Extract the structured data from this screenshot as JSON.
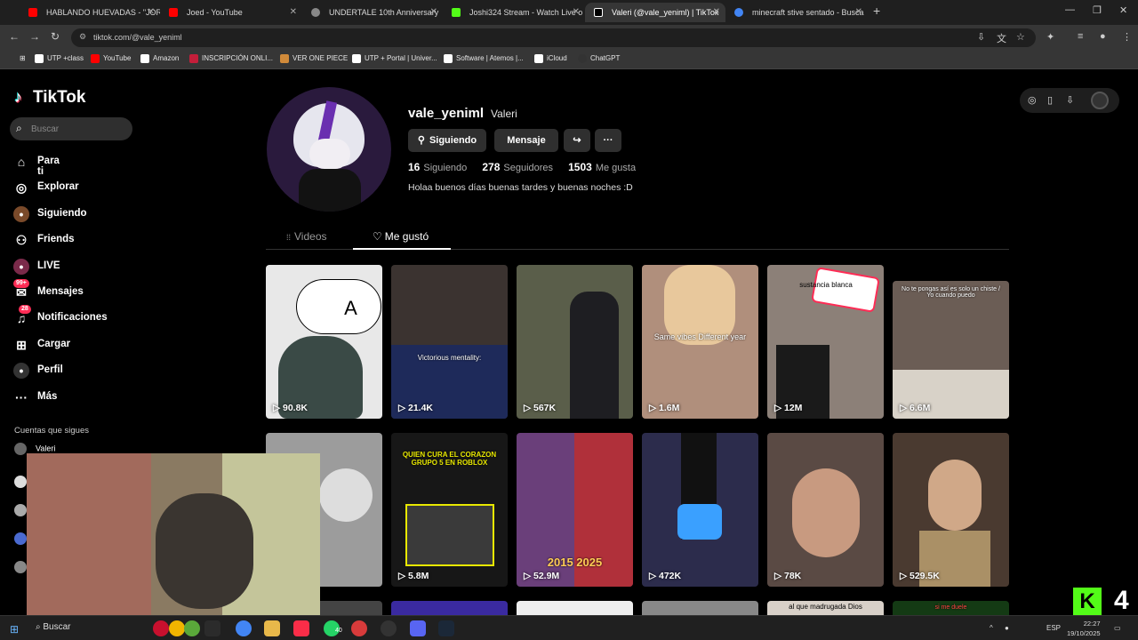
{
  "browser": {
    "tabs": [
      {
        "title": "HABLANDO HUEVADAS - \"JOR",
        "icon": "youtube-icon"
      },
      {
        "title": "Joed - YouTube",
        "icon": "youtube-icon"
      },
      {
        "title": "UNDERTALE 10th Anniversary",
        "icon": "globe-icon"
      },
      {
        "title": "Joshi324 Stream - Watch Live o",
        "icon": "kick-icon"
      },
      {
        "title": "Valeri (@vale_yeniml) | TikTok",
        "icon": "tiktok-icon"
      },
      {
        "title": "minecraft stive sentado - Busca",
        "icon": "google-icon"
      }
    ],
    "url": "tiktok.com/@vale_yeniml",
    "bookmarks": [
      "UTP +class",
      "YouTube",
      "Amazon",
      "INSCRIPCIÓN ONLI...",
      "VER ONE PIECE",
      "UTP + Portal | Univer...",
      "Software | Atemos |...",
      "iCloud",
      "ChatGPT"
    ]
  },
  "tiktok": {
    "logo": "TikTok",
    "search_placeholder": "Buscar",
    "nav": [
      {
        "label": "Para ti",
        "icon": "home-icon"
      },
      {
        "label": "Explorar",
        "icon": "compass-icon"
      },
      {
        "label": "Siguiendo",
        "icon": "following-icon"
      },
      {
        "label": "Friends",
        "icon": "friends-icon"
      },
      {
        "label": "LIVE",
        "icon": "live-icon"
      },
      {
        "label": "Mensajes",
        "icon": "messages-icon",
        "badge": "99+"
      },
      {
        "label": "Notificaciones",
        "icon": "bell-icon",
        "badge": "28"
      },
      {
        "label": "Cargar",
        "icon": "upload-icon"
      },
      {
        "label": "Perfil",
        "icon": "profile-icon"
      },
      {
        "label": "Más",
        "icon": "more-icon"
      }
    ],
    "following_title": "Cuentas que sigues",
    "following": [
      "Valeri"
    ]
  },
  "profile": {
    "username": "vale_yeniml",
    "nickname": "Valeri",
    "btn_following": "Siguiendo",
    "btn_message": "Mensaje",
    "following_count": "16",
    "following_label": "Siguiendo",
    "followers_count": "278",
    "followers_label": "Seguidores",
    "likes_count": "1503",
    "likes_label": "Me gusta",
    "bio": "Holaa buenos días buenas tardes y buenas noches :D",
    "tab_videos": "Videos",
    "tab_liked": "Me gustó"
  },
  "videos": [
    {
      "views": "90.8K",
      "caption": "A",
      "color": "#e8e8e8"
    },
    {
      "views": "21.4K",
      "caption": "Victorious mentality:",
      "color": "#3b3330"
    },
    {
      "views": "567K",
      "caption": "",
      "color": "#5a5e4a"
    },
    {
      "views": "1.6M",
      "caption": "Same vibes Different year",
      "color": "#b08f7c"
    },
    {
      "views": "12M",
      "caption": "sustancia blanca",
      "color": "#8c8078"
    },
    {
      "views": "6.6M",
      "caption": "No te pongas así es solo un chiste / Yo cuando puedo",
      "color": "#6b5d55"
    },
    {
      "views": "",
      "caption": "",
      "color": "#9c9c9c"
    },
    {
      "views": "5.8M",
      "caption": "QUIEN CURA EL CORAZON GRUPO 5 EN ROBLOX",
      "color": "#171717"
    },
    {
      "views": "52.9M",
      "caption": "2015 2025",
      "color": "#6a3f7a"
    },
    {
      "views": "472K",
      "caption": "",
      "color": "#2c2c4c"
    },
    {
      "views": "78K",
      "caption": "",
      "color": "#5a4a44"
    },
    {
      "views": "529.5K",
      "caption": "",
      "color": "#4a3a30"
    }
  ],
  "bottom_row_captions": [
    "",
    "",
    "",
    "",
    "al que madrugada Dios",
    "si me duele"
  ],
  "stream_overlay": {
    "kick_badge": "K",
    "number": "4"
  },
  "taskbar": {
    "search": "Buscar",
    "lang": "ESP",
    "time": "22:27",
    "date": "19/10/2025",
    "badge_count": "40"
  }
}
